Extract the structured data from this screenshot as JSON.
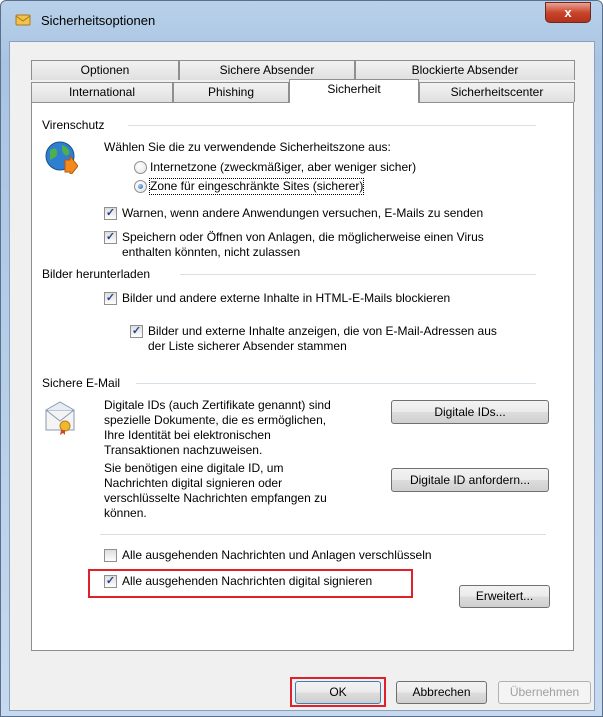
{
  "window": {
    "title": "Sicherheitsoptionen",
    "close_label": "x"
  },
  "tabs_row1": [
    "Optionen",
    "Sichere Absender",
    "Blockierte Absender"
  ],
  "tabs_row2": [
    "International",
    "Phishing",
    "Sicherheit",
    "Sicherheitscenter"
  ],
  "virus": {
    "label": "Virenschutz",
    "zone_prompt": "Wählen Sie die zu verwendende Sicherheitszone aus:",
    "zone_internet": "Internetzone (zweckmäßiger, aber weniger sicher)",
    "zone_restricted": "Zone für eingeschränkte Sites (sicherer)",
    "warn_label": "Warnen, wenn andere Anwendungen versuchen, E-Mails zu senden",
    "attach_label_1": "Speichern oder Öffnen von Anlagen, die möglicherweise einen Virus",
    "attach_label_2": "enthalten könnten, nicht zulassen"
  },
  "images": {
    "label": "Bilder herunterladen",
    "block_label": "Bilder und andere externe Inhalte in HTML-E-Mails blockieren",
    "show_label_1": "Bilder und externe Inhalte anzeigen, die von E-Mail-Adressen aus",
    "show_label_2": "der Liste sicherer Absender stammen"
  },
  "secure_mail": {
    "label": "Sichere E-Mail",
    "desc1": [
      "Digitale IDs (auch Zertifikate genannt) sind",
      "spezielle Dokumente, die es ermöglichen,",
      "Ihre Identität bei elektronischen",
      "Transaktionen nachzuweisen."
    ],
    "desc2": [
      "Sie benötigen eine digitale ID, um",
      "Nachrichten digital signieren oder",
      "verschlüsselte Nachrichten empfangen zu",
      "können."
    ],
    "btn_ids": "Digitale IDs...",
    "btn_request": "Digitale ID anfordern...",
    "encrypt_label": "Alle ausgehenden Nachrichten und Anlagen verschlüsseln",
    "sign_label": "Alle ausgehenden Nachrichten digital signieren",
    "btn_advanced": "Erweitert..."
  },
  "footer": {
    "ok": "OK",
    "cancel": "Abbrechen",
    "apply": "Übernehmen"
  },
  "colors": {
    "highlight": "#e0202a",
    "check": "#25478f"
  }
}
